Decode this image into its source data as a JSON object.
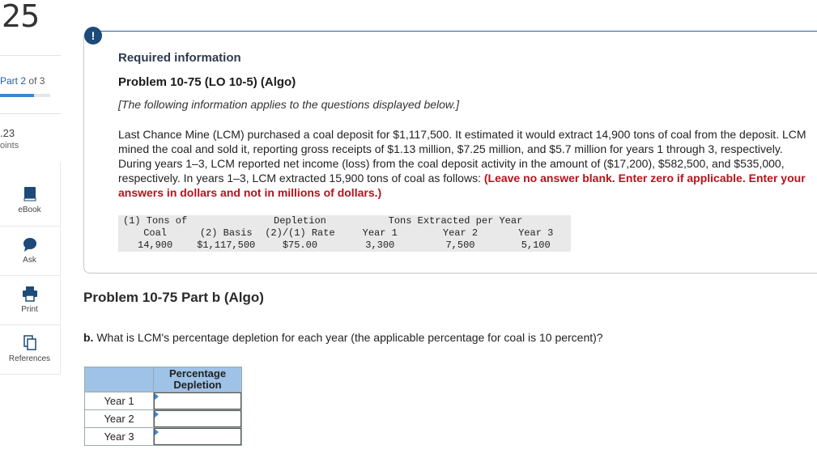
{
  "sidebar": {
    "question_number": "25",
    "part_prefix": "Part",
    "part_current": "2",
    "part_of": "of 3",
    "progress_fraction": 0.67,
    "points_value": ".23",
    "points_label": "oints",
    "tools": [
      {
        "label": "eBook",
        "icon": "book-icon"
      },
      {
        "label": "Ask",
        "icon": "chat-bubble-icon"
      },
      {
        "label": "Print",
        "icon": "printer-icon"
      },
      {
        "label": "References",
        "icon": "copy-icon"
      }
    ]
  },
  "info": {
    "alert_glyph": "!",
    "required": "Required information",
    "problem_title": "Problem 10-75 (LO 10-5) (Algo)",
    "note": "[The following information applies to the questions displayed below.]",
    "body_plain": "Last Chance Mine (LCM) purchased a coal deposit for $1,117,500. It estimated it would extract 14,900 tons of coal from the deposit. LCM mined the coal and sold it, reporting gross receipts of $1.13 million, $7.25 million, and $5.7 million for years 1 through 3, respectively. During years 1–3, LCM reported net income (loss) from the coal deposit activity in the amount of ($17,200), $582,500, and $535,000, respectively. In years 1–3, LCM extracted 15,900 tons of coal as follows: ",
    "body_red": "(Leave no answer blank. Enter zero if applicable. Enter your answers in dollars and not in millions of dollars.)",
    "table": {
      "h1_tons": "(1) Tons of",
      "h1_depletion": "Depletion",
      "h1_extracted": "Tons Extracted per Year",
      "h2_coal": "Coal",
      "h2_basis": "(2) Basis",
      "h2_rate": "(2)/(1) Rate",
      "h2_y1": "Year 1",
      "h2_y2": "Year 2",
      "h2_y3": "Year 3",
      "v_tons": "14,900",
      "v_basis": "$1,117,500",
      "v_rate": "$75.00",
      "v_y1": "3,300",
      "v_y2": "7,500",
      "v_y3": "5,100"
    }
  },
  "part": {
    "title": "Problem 10-75 Part b (Algo)",
    "question_bold": "b.",
    "question_text": " What is LCM's percentage depletion for each year (the applicable percentage for coal is 10 percent)?",
    "answer_header": "Percentage Depletion",
    "rows": [
      {
        "label": "Year 1",
        "value": ""
      },
      {
        "label": "Year 2",
        "value": ""
      },
      {
        "label": "Year 3",
        "value": ""
      }
    ]
  },
  "colors": {
    "accent": "#1c4a7a",
    "link_blue": "#1f5fa8",
    "warning_red": "#b8121b",
    "header_blue": "#9fc2e7"
  }
}
